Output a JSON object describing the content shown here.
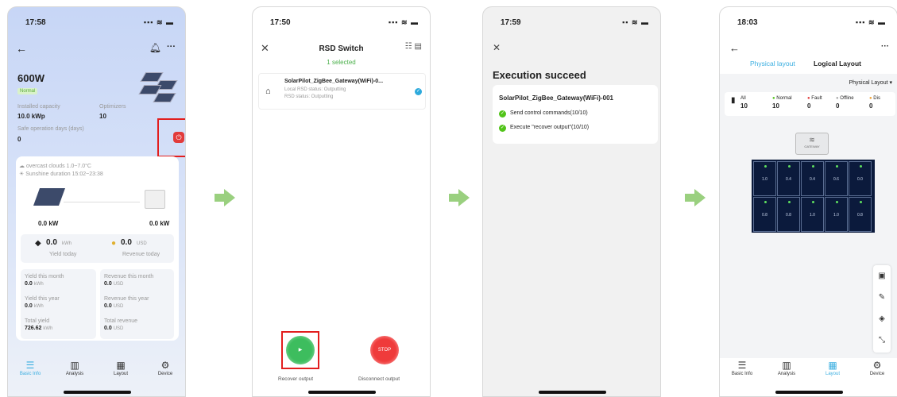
{
  "colors": {
    "accent": "#3aaee0",
    "success": "#52c41a",
    "danger": "#e21e1e",
    "arrow": "#9ad07f"
  },
  "phone1": {
    "time": "17:58",
    "signal": "▪▪▪ ≋ ▬",
    "power": "600W",
    "status": "Normal",
    "capacity_label": "Installed capacity",
    "capacity_value": "10.0 kWp",
    "optimizers_label": "Optimizers",
    "optimizers_value": "10",
    "safe_label": "Safe operation days (days)",
    "safe_value": "0",
    "weather1": "overcast clouds 1.0~7.0°C",
    "weather2": "Sunshine duration 15:02~23:38",
    "pv_kw": "0.0 kW",
    "inv_kw": "0.0 kW",
    "yield_today_value": "0.0",
    "yield_today_unit": "kWh",
    "yield_today_label": "Yield today",
    "revenue_today_value": "0.0",
    "revenue_today_unit": "USD",
    "revenue_today_label": "Revenue today",
    "stats": [
      {
        "label": "Yield this month",
        "value": "0.0",
        "unit": "kWh"
      },
      {
        "label": "Revenue this month",
        "value": "0.0",
        "unit": "USD"
      },
      {
        "label": "Yield this year",
        "value": "0.0",
        "unit": "kWh"
      },
      {
        "label": "Revenue this year",
        "value": "0.0",
        "unit": "USD"
      },
      {
        "label": "Total yield",
        "value": "726.62",
        "unit": "kWh"
      },
      {
        "label": "Total revenue",
        "value": "0.0",
        "unit": "USD"
      }
    ],
    "tabs": [
      "Basic Info",
      "Analysis",
      "Layout",
      "Device"
    ]
  },
  "phone2": {
    "time": "17:50",
    "title": "RSD Switch",
    "selected": "1 selected",
    "device_name": "SolarPilot_ZigBee_Gateway(WiFi)-0...",
    "local_status": "Local RSD status: Outputting",
    "rsd_status": "RSD status: Outputting",
    "recover_label": "Recover output",
    "disconnect_label": "Disconnect output",
    "stop_text": "STOP"
  },
  "phone3": {
    "time": "17:59",
    "title": "Execution succeed",
    "device_name": "SolarPilot_ZigBee_Gateway(WiFi)-001",
    "line1": "Send control commands(10/10)",
    "line2": "Execute \"recover output\"(10/10)"
  },
  "phone4": {
    "time": "18:03",
    "tab_physical": "Physical layout",
    "tab_logical": "Logical Layout",
    "dropdown": "Physical Layout ▾",
    "filters": [
      {
        "label": "All",
        "value": "10"
      },
      {
        "label": "Normal",
        "value": "10"
      },
      {
        "label": "Fault",
        "value": "0"
      },
      {
        "label": "Offline",
        "value": "0"
      },
      {
        "label": "Dis",
        "value": "0"
      }
    ],
    "gateway_label": "GATEWAY",
    "cells": [
      "1.0",
      "0.4",
      "0.4",
      "0.6",
      "0.0",
      "0.8",
      "0.8",
      "1.0",
      "1.0",
      "0.8"
    ],
    "tabs": [
      "Basic Info",
      "Analysis",
      "Layout",
      "Device"
    ]
  }
}
